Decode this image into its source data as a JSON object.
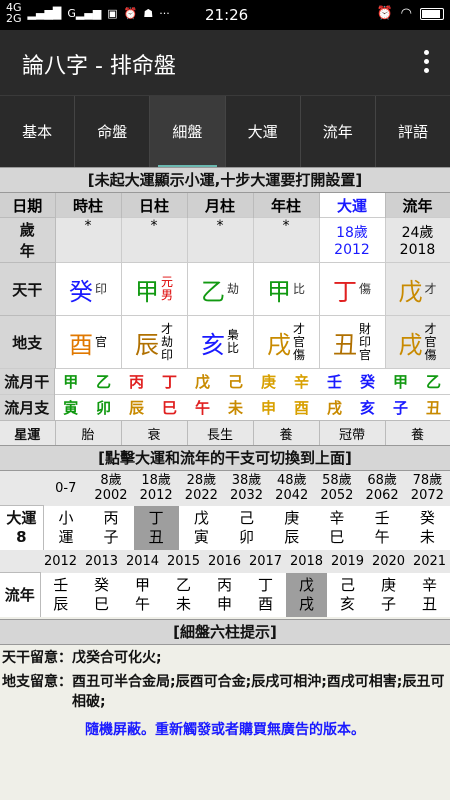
{
  "status": {
    "net1": "4G",
    "net2": "2G",
    "time": "21:26"
  },
  "app": {
    "title": "論八字 - 排命盤"
  },
  "tabs": [
    "基本",
    "命盤",
    "細盤",
    "大運",
    "流年",
    "評語"
  ],
  "active_tab": 2,
  "notice": "[未起大運顯示小運,十步大運要打開設置]",
  "headers": [
    "日期",
    "時柱",
    "日柱",
    "月柱",
    "年柱",
    "大運",
    "流年"
  ],
  "sui_label": [
    "歲",
    "年"
  ],
  "sui_values": [
    "*",
    "*",
    "*",
    "*"
  ],
  "dayun_sui": [
    "18歲",
    "2012"
  ],
  "liunian_sui": [
    "24歲",
    "2018"
  ],
  "tiangan_label": "天干",
  "dizhi_label": "地支",
  "tiangan": [
    {
      "char": "癸",
      "color": "#1a1aff",
      "sub": [
        "印"
      ],
      "subcolor": "#333"
    },
    {
      "char": "甲",
      "color": "#119911",
      "sub": [
        "元",
        "男"
      ],
      "subcolor": "#d00"
    },
    {
      "char": "乙",
      "color": "#119911",
      "sub": [
        "劫"
      ],
      "subcolor": "#333"
    },
    {
      "char": "甲",
      "color": "#119911",
      "sub": [
        "比"
      ],
      "subcolor": "#333"
    },
    {
      "char": "丁",
      "color": "#e02020",
      "sub": [
        "傷"
      ],
      "subcolor": "#333"
    },
    {
      "char": "戊",
      "color": "#c88a00",
      "sub": [
        "才"
      ],
      "subcolor": "#333"
    }
  ],
  "dizhi": [
    {
      "char": "酉",
      "color": "#e07800",
      "sub": [
        "官"
      ]
    },
    {
      "char": "辰",
      "color": "#b07000",
      "sub": [
        "才",
        "劫",
        "印"
      ]
    },
    {
      "char": "亥",
      "color": "#1a1aff",
      "sub": [
        "梟",
        "比"
      ]
    },
    {
      "char": "戌",
      "color": "#c88a00",
      "sub": [
        "才",
        "官",
        "傷"
      ]
    },
    {
      "char": "丑",
      "color": "#b07000",
      "sub": [
        "財",
        "印",
        "官"
      ]
    },
    {
      "char": "戌",
      "color": "#c88a00",
      "sub": [
        "才",
        "官",
        "傷"
      ]
    }
  ],
  "liuyue_gan_label": "流月干",
  "liuyue_zhi_label": "流月支",
  "liuyue_gan": [
    {
      "c": "甲",
      "col": "#119911"
    },
    {
      "c": "乙",
      "col": "#119911"
    },
    {
      "c": "丙",
      "col": "#e02020"
    },
    {
      "c": "丁",
      "col": "#e02020"
    },
    {
      "c": "戊",
      "col": "#c88a00"
    },
    {
      "c": "己",
      "col": "#c88a00"
    },
    {
      "c": "庚",
      "col": "#d8a000"
    },
    {
      "c": "辛",
      "col": "#d8a000"
    },
    {
      "c": "壬",
      "col": "#1a1aff"
    },
    {
      "c": "癸",
      "col": "#1a1aff"
    },
    {
      "c": "甲",
      "col": "#119911"
    },
    {
      "c": "乙",
      "col": "#119911"
    }
  ],
  "liuyue_zhi": [
    {
      "c": "寅",
      "col": "#119911"
    },
    {
      "c": "卯",
      "col": "#119911"
    },
    {
      "c": "辰",
      "col": "#c88a00"
    },
    {
      "c": "巳",
      "col": "#e02020"
    },
    {
      "c": "午",
      "col": "#e02020"
    },
    {
      "c": "未",
      "col": "#c88a00"
    },
    {
      "c": "申",
      "col": "#d8a000"
    },
    {
      "c": "酉",
      "col": "#d8a000"
    },
    {
      "c": "戌",
      "col": "#c88a00"
    },
    {
      "c": "亥",
      "col": "#1a1aff"
    },
    {
      "c": "子",
      "col": "#1a1aff"
    },
    {
      "c": "丑",
      "col": "#c88a00"
    }
  ],
  "xingyun_label": "星運",
  "xingyun": [
    "胎",
    "衰",
    "長生",
    "養",
    "冠帶",
    "養"
  ],
  "click_notice": "[點擊大運和流年的干支可切換到上面]",
  "dayun_ages": [
    {
      "a": "0-7",
      "y": ""
    },
    {
      "a": "8歲",
      "y": "2002"
    },
    {
      "a": "18歲",
      "y": "2012"
    },
    {
      "a": "28歲",
      "y": "2022"
    },
    {
      "a": "38歲",
      "y": "2032"
    },
    {
      "a": "48歲",
      "y": "2042"
    },
    {
      "a": "58歲",
      "y": "2052"
    },
    {
      "a": "68歲",
      "y": "2062"
    },
    {
      "a": "78歲",
      "y": "2072"
    }
  ],
  "dayun_label": [
    "大運",
    "8"
  ],
  "dayun_pillars": [
    [
      "小",
      "運"
    ],
    [
      "丙",
      "子"
    ],
    [
      "丁",
      "丑"
    ],
    [
      "戊",
      "寅"
    ],
    [
      "己",
      "卯"
    ],
    [
      "庚",
      "辰"
    ],
    [
      "辛",
      "巳"
    ],
    [
      "壬",
      "午"
    ],
    [
      "癸",
      "未"
    ]
  ],
  "liunian_years": [
    "2012",
    "2013",
    "2014",
    "2015",
    "2016",
    "2017",
    "2018",
    "2019",
    "2020",
    "2021"
  ],
  "liunian_label": "流年",
  "liunian_pillars": [
    [
      "壬",
      "辰"
    ],
    [
      "癸",
      "巳"
    ],
    [
      "甲",
      "午"
    ],
    [
      "乙",
      "未"
    ],
    [
      "丙",
      "申"
    ],
    [
      "丁",
      "酉"
    ],
    [
      "戊",
      "戌"
    ],
    [
      "己",
      "亥"
    ],
    [
      "庚",
      "子"
    ],
    [
      "辛",
      "丑"
    ]
  ],
  "detail_title": "[細盤六柱提示]",
  "tiangan_note_k": "天干留意：",
  "tiangan_note_v": "戊癸合可化火;",
  "dizhi_note_k": "地支留意：",
  "dizhi_note_v": "酉丑可半合金局;辰酉可合金;辰戌可相沖;酉戌可相害;辰丑可相破;",
  "ad_text": "隨機屏蔽。重新觸發或者購買無廣告的版本。"
}
